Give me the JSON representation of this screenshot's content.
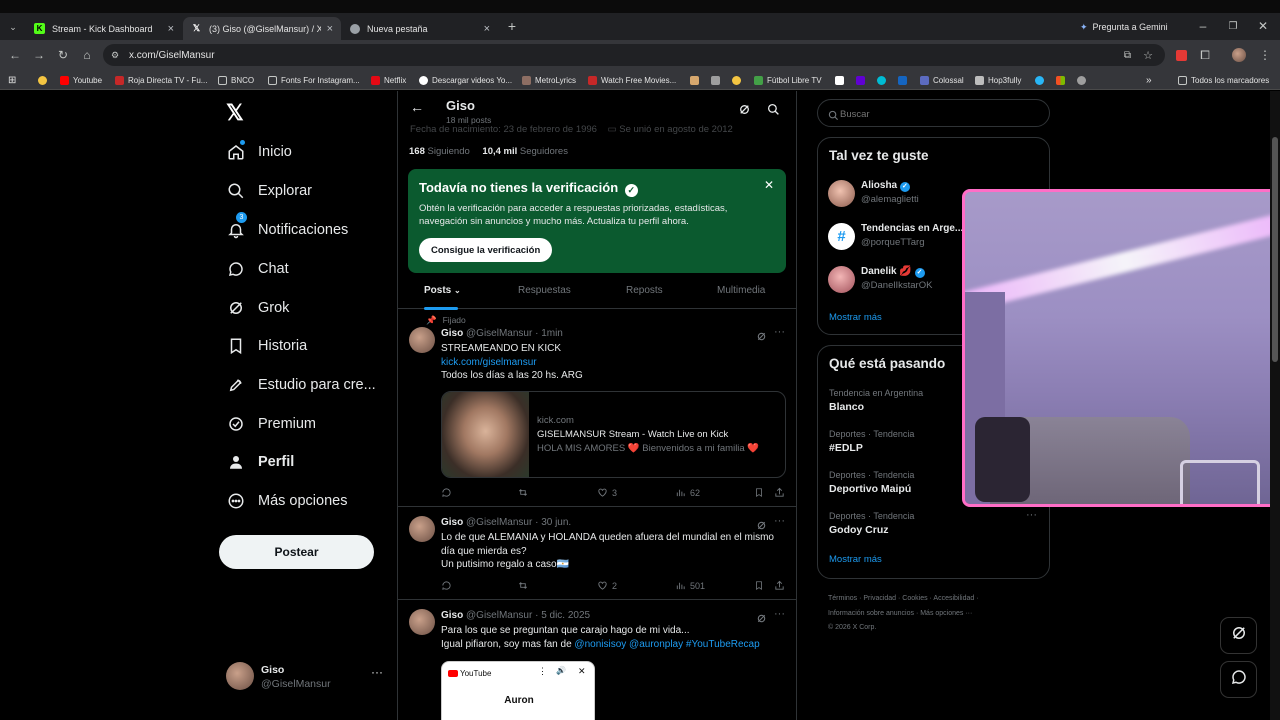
{
  "browser": {
    "tabs": [
      {
        "title": "Stream - Kick Dashboard",
        "icon": "kick-icon"
      },
      {
        "title": "(3) Giso (@GiselMansur) / X",
        "icon": "x-icon"
      },
      {
        "title": "Nueva pestaña",
        "icon": "chrome-icon"
      }
    ],
    "gemini_label": "Pregunta a Gemini",
    "url": "x.com/GiselMansur",
    "bookmarks": [
      "Youtube",
      "Roja Directa TV - Fu...",
      "BNCO",
      "Fonts For Instagram...",
      "Netflix",
      "Descargar videos Yo...",
      "MetroLyrics",
      "Watch Free Movies...",
      "Fútbol Libre TV",
      "Colossal",
      "Hop3fully"
    ],
    "all_bookmarks": "Todos los marcadores"
  },
  "sidebar": {
    "items": [
      {
        "label": "Inicio",
        "icon": "home-icon"
      },
      {
        "label": "Explorar",
        "icon": "search-icon"
      },
      {
        "label": "Notificaciones",
        "icon": "bell-icon",
        "badge": "3"
      },
      {
        "label": "Chat",
        "icon": "chat-icon"
      },
      {
        "label": "Grok",
        "icon": "grok-icon"
      },
      {
        "label": "Historia",
        "icon": "bookmark-icon"
      },
      {
        "label": "Estudio para cre...",
        "icon": "rocket-icon"
      },
      {
        "label": "Premium",
        "icon": "verified-icon"
      },
      {
        "label": "Perfil",
        "icon": "person-icon"
      },
      {
        "label": "Más opciones",
        "icon": "more-icon"
      }
    ],
    "post_button": "Postear",
    "account": {
      "name": "Giso",
      "handle": "@GiselMansur"
    }
  },
  "profile": {
    "name": "Giso",
    "posts_count": "18 mil posts",
    "birth": "Fecha de nacimiento: 23 de febrero de 1996",
    "joined": "Se unió en agosto de 2012",
    "following_count": "168",
    "following_label": "Siguiendo",
    "followers_count": "10,4 mil",
    "followers_label": "Seguidores"
  },
  "verification_banner": {
    "title": "Todavía no tienes la verificación",
    "body": "Obtén la verificación para acceder a respuestas priorizadas, estadísticas, navegación sin anuncios y mucho más. Actualiza tu perfil ahora.",
    "button": "Consigue la verificación",
    "bg": "#0b5a2f"
  },
  "profile_tabs": [
    "Posts",
    "Respuestas",
    "Reposts",
    "Multimedia"
  ],
  "tweets": [
    {
      "pinned": "Fijado",
      "name": "Giso",
      "handle": "@GiselMansur",
      "time": "1min",
      "line1": "STREAMEANDO EN KICK",
      "link": "kick.com/giselmansur",
      "line2": "Todos los días a las 20 hs. ARG",
      "card": {
        "domain": "kick.com",
        "title": "GISELMANSUR Stream - Watch Live on Kick",
        "desc": "HOLA MIS AMORES ❤️ Bienvenidos a mi familia ❤️"
      },
      "likes": "3",
      "views": "62"
    },
    {
      "name": "Giso",
      "handle": "@GiselMansur",
      "time": "30 jun.",
      "line1": "Lo de que ALEMANIA y HOLANDA queden afuera del mundial en el mismo día que mierda es?",
      "line2": "Un putisimo regalo a caso🇦🇷",
      "likes": "2",
      "views": "501"
    },
    {
      "name": "Giso",
      "handle": "@GiselMansur",
      "time": "5 dic. 2025",
      "line1": "Para los que se preguntan que carajo hago de mi vida...",
      "line2_prefix": "Igual pifiaron, soy mas fan de ",
      "mentions": "@nonisisoy @auronplay #YouTubeRecap",
      "embed": {
        "brand": "YouTube",
        "title": "Auron"
      }
    }
  ],
  "right": {
    "search_placeholder": "Buscar",
    "suggest_title": "Tal vez te guste",
    "suggestions": [
      {
        "name": "Aliosha",
        "handle": "@alemaglietti",
        "verified": true
      },
      {
        "name": "Tendencias en Arge...",
        "handle": "@porqueTTarg",
        "verified": false
      },
      {
        "name": "Danelik 💋",
        "handle": "@DanelIkstarOK",
        "verified": true
      }
    ],
    "show_more": "Mostrar más",
    "trends_title": "Qué está pasando",
    "trends": [
      {
        "category": "Tendencia en Argentina",
        "name": "Blanco"
      },
      {
        "category": "Deportes · Tendencia",
        "name": "#EDLP"
      },
      {
        "category": "Deportes · Tendencia",
        "name": "Deportivo Maipú"
      },
      {
        "category": "Deportes · Tendencia",
        "name": "Godoy Cruz"
      }
    ],
    "trends_more": "Mostrar más",
    "footer1": "Términos · Privacidad · Cookies · Accesibilidad ·",
    "footer2": "Información sobre anuncios · Más opciones ···",
    "footer3": "© 2026 X Corp."
  },
  "colors": {
    "accent": "#1d9bf0",
    "overlay_border": "#ff6ec7",
    "banner": "#0b5a2f"
  }
}
